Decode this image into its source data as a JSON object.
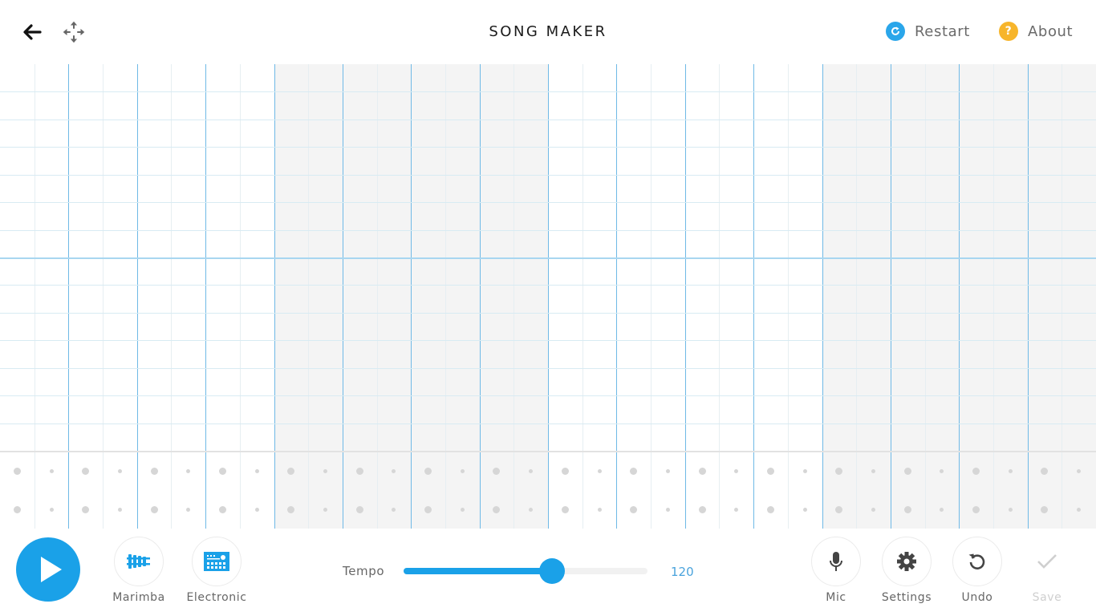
{
  "header": {
    "title": "SONG MAKER",
    "back_icon": "arrow-left-icon",
    "move_icon": "move-arrows-icon",
    "restart": {
      "label": "Restart",
      "icon": "refresh-icon",
      "color": "#2aa6ea"
    },
    "about": {
      "label": "About",
      "icon": "question-icon",
      "icon_glyph": "?",
      "color": "#f7b52b"
    }
  },
  "grid": {
    "measures": 4,
    "beats_per_measure": 4,
    "subdivisions_per_beat": 2,
    "columns": 32,
    "melody_rows": 14,
    "octave_divider_after_row": 7,
    "percussion_rows": 2,
    "shaded_measures": [
      2,
      4
    ],
    "accent_color": "#6fb9e6",
    "shade_color": "#f4f4f4"
  },
  "controls": {
    "play": {
      "label": "Play",
      "icon": "play-icon",
      "color": "#1aa1e8"
    },
    "instruments": [
      {
        "label": "Marimba",
        "icon": "marimba-icon"
      },
      {
        "label": "Electronic",
        "icon": "drum-machine-icon"
      }
    ],
    "tempo": {
      "label": "Tempo",
      "value": "120",
      "fill_fraction": 0.61
    },
    "actions": [
      {
        "label": "Mic",
        "icon": "microphone-icon",
        "enabled": true
      },
      {
        "label": "Settings",
        "icon": "gear-icon",
        "enabled": true
      },
      {
        "label": "Undo",
        "icon": "undo-icon",
        "enabled": true
      },
      {
        "label": "Save",
        "icon": "check-icon",
        "enabled": false
      }
    ]
  }
}
